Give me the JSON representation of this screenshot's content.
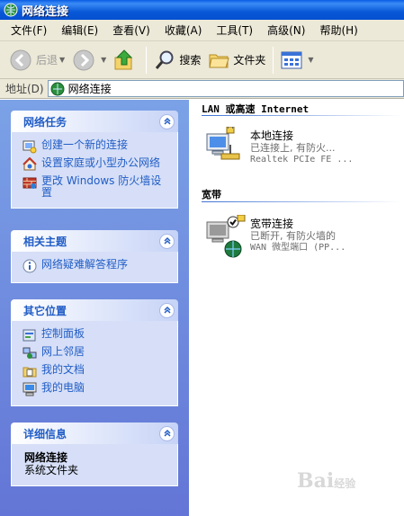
{
  "window": {
    "title": "网络连接"
  },
  "menu": [
    {
      "label": "文件(F)"
    },
    {
      "label": "编辑(E)"
    },
    {
      "label": "查看(V)"
    },
    {
      "label": "收藏(A)"
    },
    {
      "label": "工具(T)"
    },
    {
      "label": "高级(N)"
    },
    {
      "label": "帮助(H)"
    }
  ],
  "toolbar": {
    "back_label": "后退",
    "search_label": "搜索",
    "folders_label": "文件夹"
  },
  "address": {
    "label": "地址(D)",
    "value": "网络连接"
  },
  "left": {
    "network_tasks": {
      "title": "网络任务",
      "items": [
        {
          "label": "创建一个新的连接",
          "icon": "new-connection-icon"
        },
        {
          "label": "设置家庭或小型办公网络",
          "icon": "home-network-icon"
        },
        {
          "label": "更改 Windows 防火墙设置",
          "icon": "firewall-icon"
        }
      ]
    },
    "related": {
      "title": "相关主题",
      "items": [
        {
          "label": "网络疑难解答程序",
          "icon": "info-icon"
        }
      ]
    },
    "other_places": {
      "title": "其它位置",
      "items": [
        {
          "label": "控制面板",
          "icon": "control-panel-icon"
        },
        {
          "label": "网上邻居",
          "icon": "network-places-icon"
        },
        {
          "label": "我的文档",
          "icon": "my-documents-icon"
        },
        {
          "label": "我的电脑",
          "icon": "my-computer-icon"
        }
      ]
    },
    "details": {
      "title": "详细信息",
      "name": "网络连接",
      "type": "系统文件夹"
    }
  },
  "content": {
    "lan_group": {
      "title": "LAN 或高速 Internet",
      "connections": [
        {
          "name": "本地连接",
          "status": "已连接上, 有防火...",
          "device": "Realtek PCIe FE ..."
        }
      ]
    },
    "broadband_group": {
      "title": "宽带",
      "connections": [
        {
          "name": "宽带连接",
          "status": "已断开, 有防火墙的",
          "device": "WAN 微型端口 (PP..."
        }
      ]
    }
  },
  "watermark": {
    "brand": "Bai",
    "suffix": "经验"
  },
  "colors": {
    "titlebar": "#0858d8",
    "task_link": "#215dc6",
    "pane_bg": "#6375d6"
  }
}
